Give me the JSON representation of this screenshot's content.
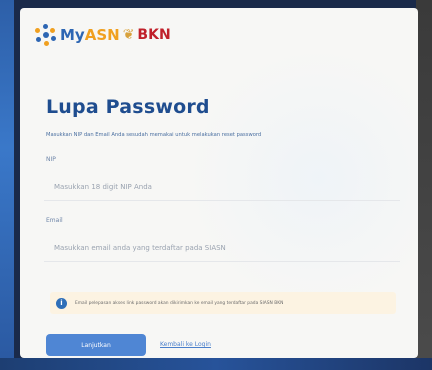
{
  "logo": {
    "brand_my": "My",
    "brand_asn": "ASN",
    "partner": "BKN"
  },
  "form": {
    "title": "Lupa Password",
    "subtitle": "Masukkan NIP dan Email Anda sesudah memakai untuk melakukan reset password",
    "nip": {
      "label": "NIP",
      "placeholder": "Masukkan 18 digit NIP Anda"
    },
    "email": {
      "label": "Email",
      "placeholder": "Masukkan email anda yang terdaftar pada SIASN"
    },
    "alert": {
      "text": "Email pelepasan akses link password akan dikirimkan ke email yang terdaftar pada SIASN BKN"
    },
    "submit_label": "Lanjutkan",
    "back_link": "Kembali ke Login"
  },
  "colors": {
    "primary": "#4f86d4",
    "title": "#1f4d8f",
    "alert_bg": "#fcf3e2",
    "bkn_red": "#c0202a",
    "asn_orange": "#f0a020"
  }
}
